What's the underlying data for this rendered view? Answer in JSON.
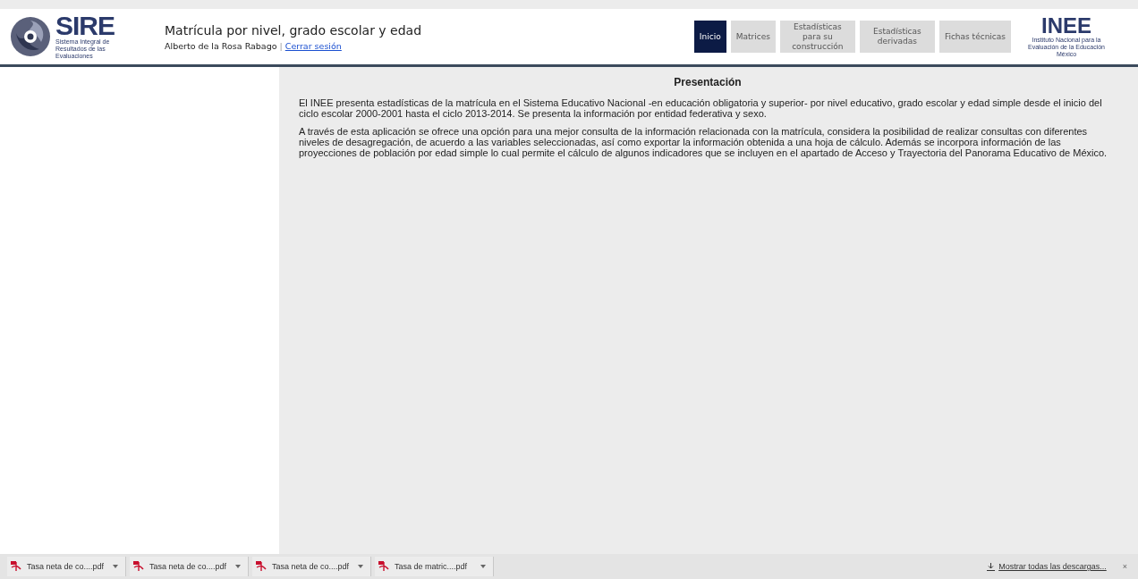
{
  "header": {
    "logo": {
      "wordmark": "SIRE",
      "caption": "Sistema Integral de Resultados de las Evaluaciones"
    },
    "title": "Matrícula por nivel, grado escolar y edad",
    "user": "Alberto de la Rosa Rabago",
    "separator": "|",
    "logout": "Cerrar sesión",
    "nav": [
      {
        "label": "Inicio",
        "selected": true
      },
      {
        "label": "Matrices",
        "selected": false
      },
      {
        "label": "Estadísticas para su construcción",
        "selected": false
      },
      {
        "label": "Estadísticas derivadas",
        "selected": false
      },
      {
        "label": "Fichas técnicas",
        "selected": false
      }
    ],
    "partner_logo": {
      "wordmark": "INEE",
      "caption": "Instituto Nacional para la Evaluación de la Educación",
      "country": "México"
    }
  },
  "content": {
    "heading": "Presentación",
    "paragraphs": [
      "El INEE presenta estadísticas de la matrícula en el Sistema Educativo Nacional -en educación obligatoria y superior- por nivel educativo, grado escolar y edad simple desde el inicio del ciclo escolar 2000-2001 hasta el ciclo 2013-2014. Se presenta la información por entidad federativa y sexo.",
      "A través de esta aplicación se ofrece una opción para una mejor consulta de la información relacionada con la matrícula, considera la posibilidad de realizar consultas con diferentes niveles de desagregación, de acuerdo a las variables seleccionadas, así como exportar la información obtenida a una hoja de cálculo. Además se incorpora información de las proyecciones de población por edad simple lo cual permite el cálculo de algunos indicadores que se incluyen en el apartado de Acceso y Trayectoria del Panorama Educativo de México."
    ]
  },
  "downloads": {
    "items": [
      {
        "name": "Tasa neta de co....pdf"
      },
      {
        "name": "Tasa neta de co....pdf"
      },
      {
        "name": "Tasa neta de co....pdf"
      },
      {
        "name": "Tasa de matric....pdf"
      }
    ],
    "show_all": "Mostrar todas las descargas...",
    "close": "×"
  }
}
